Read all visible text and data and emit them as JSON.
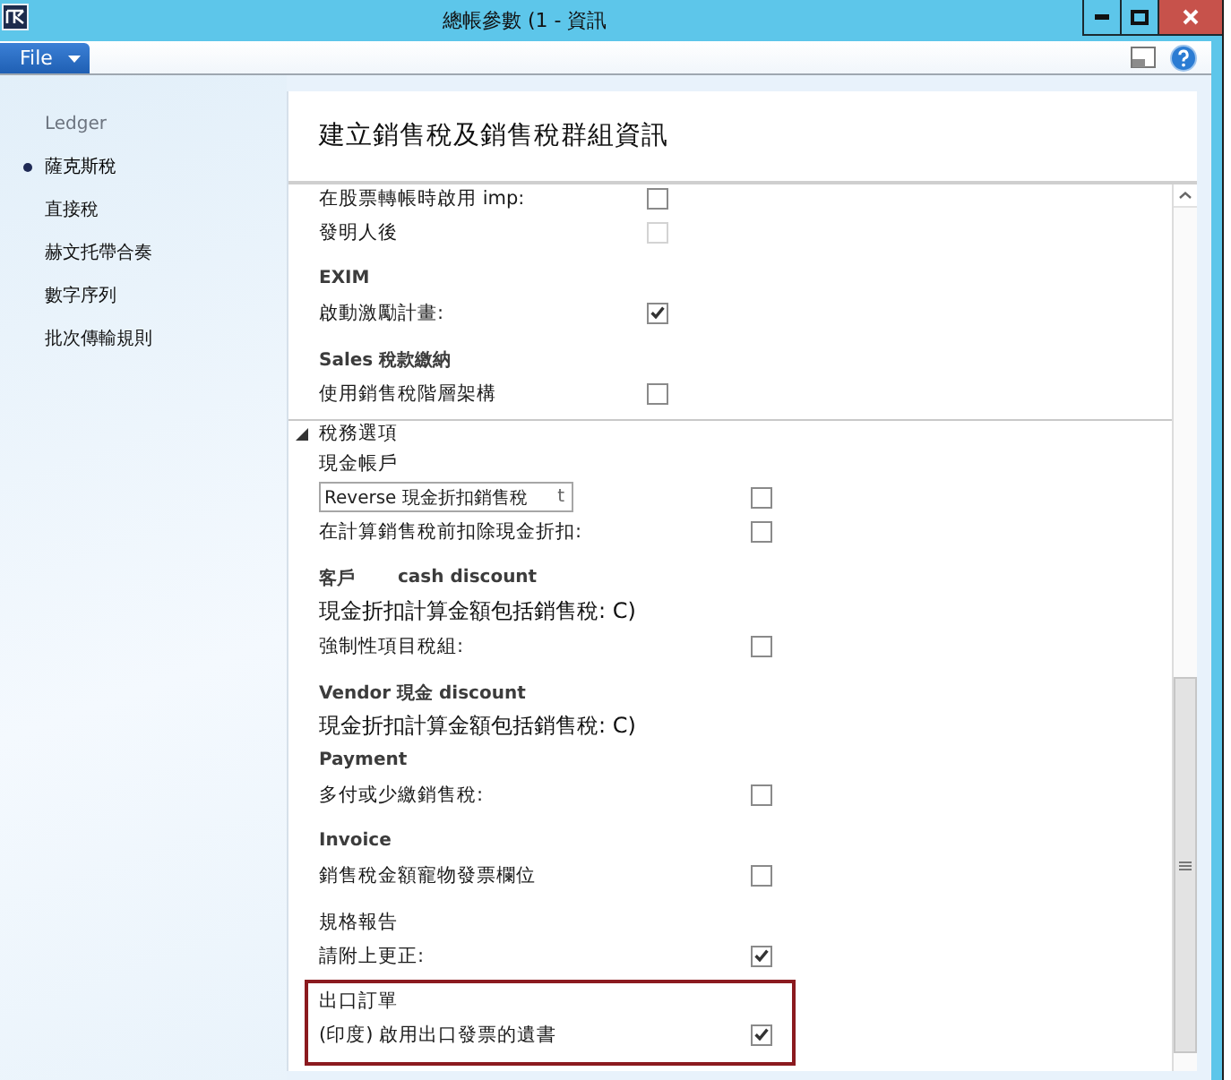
{
  "window": {
    "title": "總帳參數 (1 - 資訊"
  },
  "menu": {
    "file_button": "File"
  },
  "sidebar": {
    "heading": "Ledger",
    "items": [
      {
        "label": "薩克斯稅",
        "selected": true
      },
      {
        "label": "直接稅",
        "selected": false
      },
      {
        "label": "赫文托帶合奏",
        "selected": false
      },
      {
        "label": "數字序列",
        "selected": false
      },
      {
        "label": "批次傳輸規則",
        "selected": false
      }
    ]
  },
  "page": {
    "title": "建立銷售稅及銷售稅群組資訊"
  },
  "sections": [
    {
      "rows": [
        {
          "kind": "checkbox",
          "label": "在股票轉帳時啟用 imp:",
          "checked": false,
          "disabled": false
        },
        {
          "kind": "checkbox",
          "label": "發明人後",
          "checked": false,
          "disabled": true
        },
        {
          "kind": "heading",
          "parts": [
            "EXIM"
          ]
        },
        {
          "kind": "checkbox",
          "label": "啟動激勵計畫:",
          "checked": true,
          "disabled": false
        },
        {
          "kind": "heading",
          "parts": [
            "Sales 稅款繳納"
          ]
        },
        {
          "kind": "checkbox",
          "label": "使用銷售稅階層架構",
          "checked": false,
          "disabled": false
        }
      ]
    },
    {
      "title": "稅務選項",
      "expanded": true,
      "rows": [
        {
          "kind": "label",
          "text": "現金帳戶"
        },
        {
          "kind": "field",
          "value": "Reverse 現金折扣銷售稅",
          "trailing": "t",
          "checked": false,
          "disabled": false
        },
        {
          "kind": "checkbox",
          "label": "在計算銷售稅前扣除現金折扣:",
          "checked": false,
          "disabled": false
        },
        {
          "kind": "heading",
          "parts": [
            "客戶",
            "cash discount"
          ]
        },
        {
          "kind": "text",
          "text": "現金折扣計算金額包括銷售稅: C)"
        },
        {
          "kind": "checkbox",
          "label": "強制性項目稅組:",
          "checked": false,
          "disabled": false
        },
        {
          "kind": "heading",
          "parts": [
            "Vendor 現金 discount"
          ]
        },
        {
          "kind": "text",
          "text": "現金折扣計算金額包括銷售稅: C)"
        },
        {
          "kind": "heading",
          "parts": [
            "Payment"
          ]
        },
        {
          "kind": "checkbox",
          "label": "多付或少繳銷售稅:",
          "checked": false,
          "disabled": false
        },
        {
          "kind": "heading",
          "parts": [
            "Invoice"
          ]
        },
        {
          "kind": "checkbox",
          "label": "銷售稅金額寵物發票欄位",
          "checked": false,
          "disabled": false
        },
        {
          "kind": "label",
          "text": "規格報告"
        },
        {
          "kind": "checkbox",
          "label": "請附上更正:",
          "checked": true,
          "disabled": false
        },
        {
          "kind": "group",
          "highlighted": true,
          "rows": [
            {
              "kind": "label",
              "text": "出口訂單"
            },
            {
              "kind": "checkbox",
              "label": "(印度) 啟用出口發票的遺書",
              "checked": true,
              "disabled": false
            }
          ]
        }
      ]
    }
  ]
}
